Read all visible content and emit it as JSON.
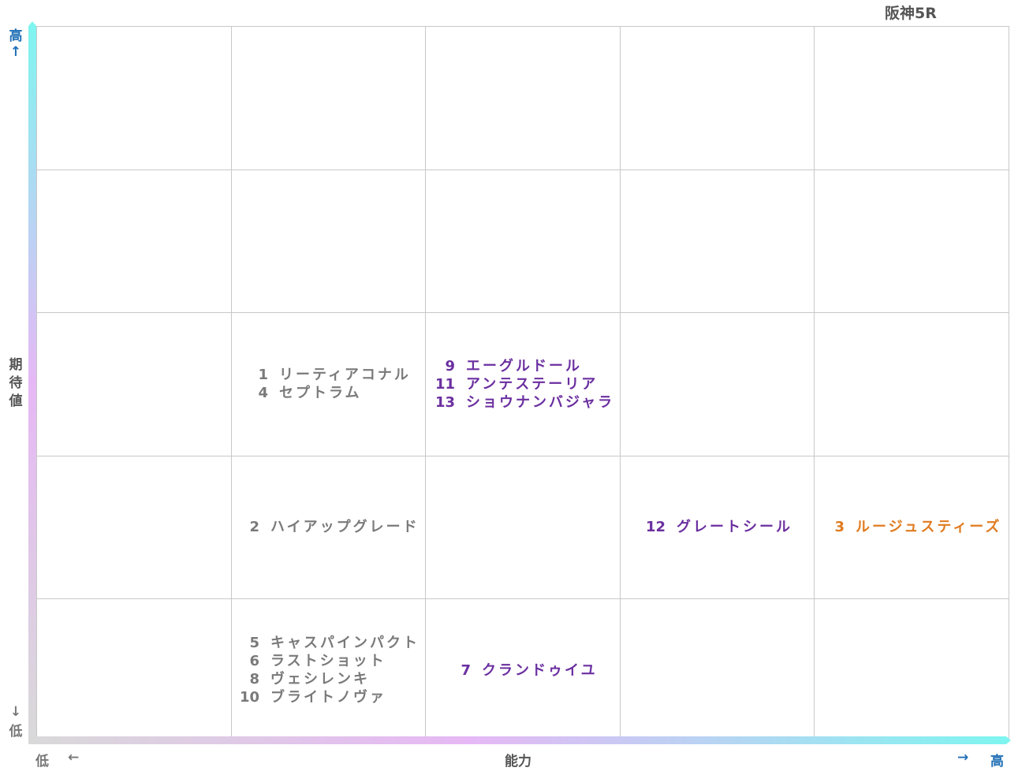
{
  "chart_data": {
    "type": "scatter",
    "title": "阪神5R",
    "xlabel": "能力",
    "ylabel": "期待値",
    "x_low_label": "低",
    "x_high_label": "高",
    "y_low_label": "低",
    "y_high_label": "高",
    "arrow_left": "←",
    "arrow_right": "→",
    "arrow_up": "↑",
    "arrow_down": "↓",
    "grid_cols": 5,
    "grid_rows": 5,
    "grid": true,
    "colors": {
      "gray": "#7a7a7a",
      "purple": "#6b2fa0",
      "orange": "#e07b20",
      "high_blue": "#1f6fb5",
      "gradient_start": "#d9d9d9",
      "gradient_mid": "#e6b8f5",
      "gradient_end": "#7ff5f0"
    },
    "groups": [
      {
        "col": 2,
        "row": 3,
        "color": "gray",
        "horses": [
          {
            "num": "1",
            "name": "リーティアコナル"
          },
          {
            "num": "4",
            "name": "セプトラム"
          }
        ]
      },
      {
        "col": 3,
        "row": 3,
        "color": "purple",
        "horses": [
          {
            "num": "9",
            "name": "エーグルドール"
          },
          {
            "num": "11",
            "name": "アンテステーリア"
          },
          {
            "num": "13",
            "name": "ショウナンバジャラ"
          }
        ]
      },
      {
        "col": 2,
        "row": 2,
        "color": "gray",
        "horses": [
          {
            "num": "2",
            "name": "ハイアップグレード"
          }
        ]
      },
      {
        "col": 4,
        "row": 2,
        "color": "purple",
        "horses": [
          {
            "num": "12",
            "name": "グレートシール"
          }
        ]
      },
      {
        "col": 5,
        "row": 2,
        "color": "orange",
        "horses": [
          {
            "num": "3",
            "name": "ルージュスティーズ"
          }
        ]
      },
      {
        "col": 2,
        "row": 1,
        "color": "gray",
        "horses": [
          {
            "num": "5",
            "name": "キャスパインパクト"
          },
          {
            "num": "6",
            "name": "ラストショット"
          },
          {
            "num": "8",
            "name": "ヴェシレンキ"
          },
          {
            "num": "10",
            "name": "ブライトノヴァ"
          }
        ]
      },
      {
        "col": 3,
        "row": 1,
        "color": "purple",
        "horses": [
          {
            "num": "7",
            "name": "クランドゥイユ"
          }
        ]
      }
    ]
  }
}
